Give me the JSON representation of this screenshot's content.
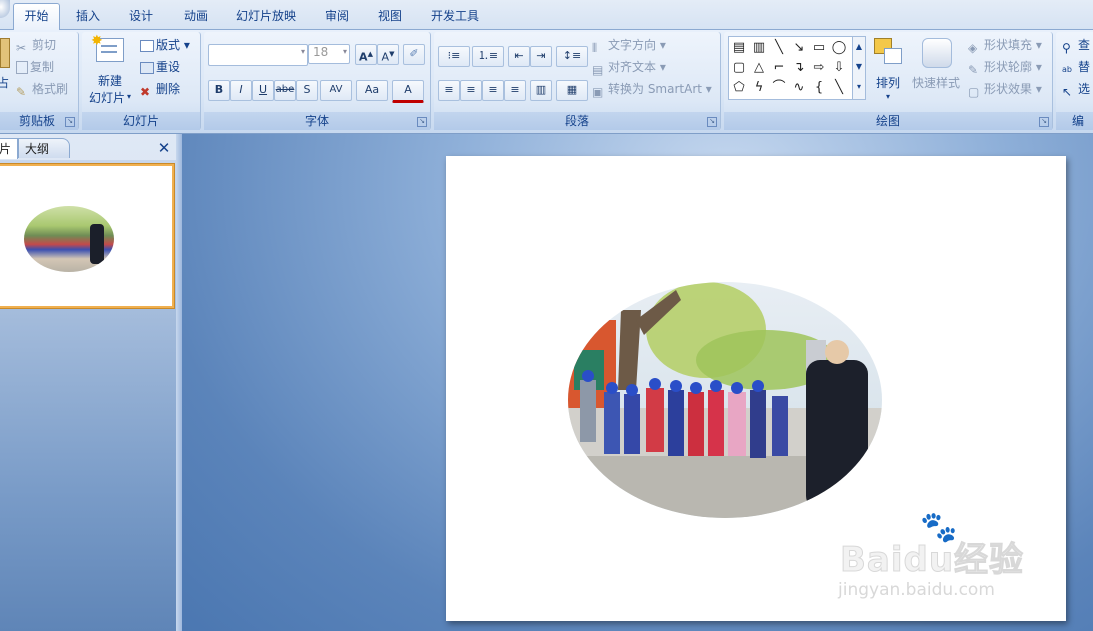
{
  "tabs": [
    "开始",
    "插入",
    "设计",
    "动画",
    "幻灯片放映",
    "审阅",
    "视图",
    "开发工具"
  ],
  "clipboard": {
    "paste_partial": "占",
    "cut": "剪切",
    "copy": "复制",
    "format_painter": "格式刷",
    "group": "剪贴板"
  },
  "slides": {
    "new_slide_line1": "新建",
    "new_slide_line2": "幻灯片",
    "layout": "版式",
    "reset": "重设",
    "delete": "删除",
    "group": "幻灯片"
  },
  "font": {
    "name_value": "",
    "size_value": "18",
    "group": "字体",
    "bold": "B",
    "italic": "I",
    "underline": "U",
    "strike": "abe",
    "shadow": "S",
    "spacing": "AV",
    "case": "Aa",
    "color": "A"
  },
  "paragraph": {
    "text_direction": "文字方向",
    "align_text": "对齐文本",
    "convert_smartart": "转换为 SmartArt",
    "group": "段落"
  },
  "drawing": {
    "arrange": "排列",
    "quick_styles": "快速样式",
    "shape_fill": "形状填充",
    "shape_outline": "形状轮廓",
    "shape_effects": "形状效果",
    "group": "绘图"
  },
  "editing": {
    "find": "查",
    "replace": "替",
    "select": "选",
    "group": "编"
  },
  "pane": {
    "tab_slides_partial": "片",
    "tab_outline": "大纲",
    "close": "✕"
  },
  "watermark": {
    "logo": "Baidu经验",
    "url": "jingyan.baidu.com"
  },
  "colors": {
    "accent": "#15428b",
    "ribbon": "#dbe7f6",
    "slide_bg": "#ffffff"
  },
  "icons": [
    "cut-icon",
    "copy-icon",
    "format-painter-icon",
    "new-slide-icon",
    "layout-icon",
    "reset-icon",
    "delete-icon",
    "close-icon"
  ]
}
